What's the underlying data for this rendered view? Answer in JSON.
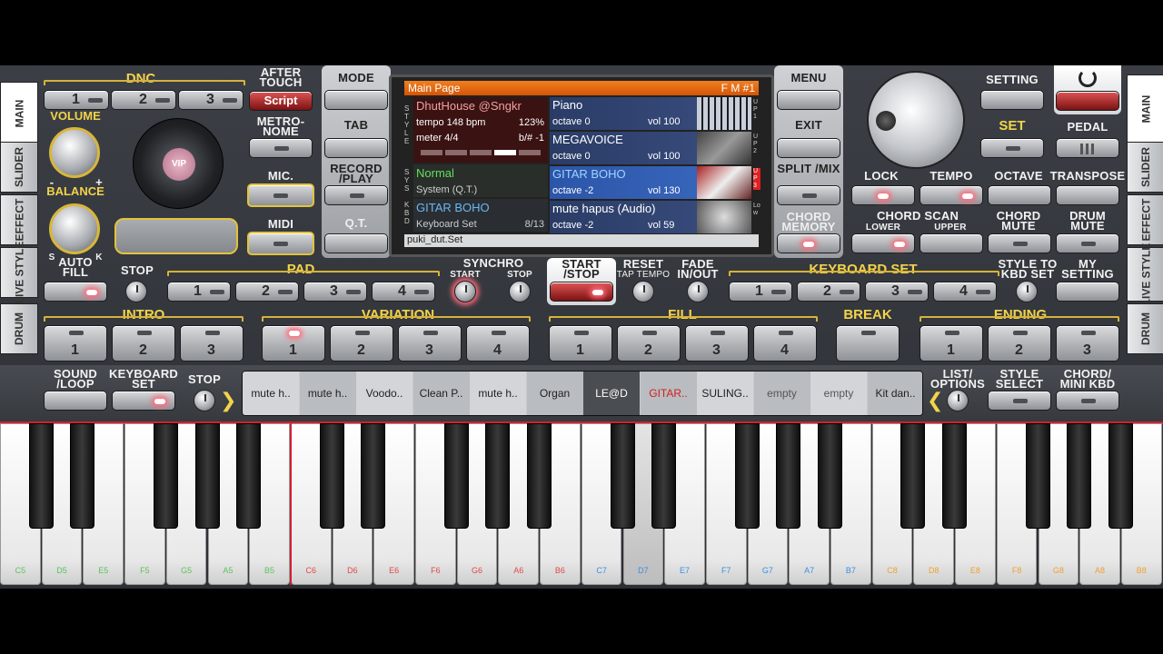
{
  "tabs_left": [
    "MAIN",
    "SLIDER",
    "EFFECT",
    "LIVE STYLE",
    "DRUM"
  ],
  "tabs_right": [
    "MAIN",
    "SLIDER",
    "EFFECT",
    "LIVE STYLE",
    "DRUM"
  ],
  "dnc": {
    "title": "DNC",
    "buttons": [
      "1",
      "2",
      "3"
    ]
  },
  "after_touch": {
    "label": "AFTER TOUCH",
    "value": "Script"
  },
  "metronome": "METRO- NOME",
  "mic": "MIC.",
  "midi": "MIDI",
  "volume": "VOLUME",
  "balance": "BALANCE",
  "balance_marks": {
    "minus": "-",
    "plus": "+",
    "s": "S",
    "k": "K"
  },
  "vip_logo": "VIP",
  "left_column": {
    "mode": "MODE",
    "tab": "TAB",
    "record": "RECORD /PLAY",
    "qt": "Q.T."
  },
  "right_column": {
    "menu": "MENU",
    "exit": "EXIT",
    "split": "SPLIT /MIX",
    "chord_memory": "CHORD MEMORY"
  },
  "screen": {
    "header": "Main Page",
    "fm": "F M #1",
    "side_style": "STYLE",
    "side_sys": "SYS",
    "side_kbd": "KBD",
    "style_name": "DhutHouse @Sngkr",
    "tempo": "tempo 148 bpm",
    "tempo_pct": "123%",
    "meter": "meter 4/4",
    "transpose": "b/# -1",
    "system_name": "Normal",
    "system_sub": "System (Q.T.)",
    "kbd_name": "GITAR BOHO",
    "kbd_sub": "Keyboard Set",
    "kbd_count": "8/13",
    "parts": [
      {
        "name": "Piano",
        "octave": "octave 0",
        "vol": "vol 100",
        "tag": "UP1"
      },
      {
        "name": "MEGAVOICE",
        "octave": "octave 0",
        "vol": "vol 100",
        "tag": "UP2"
      },
      {
        "name": "GITAR BOHO",
        "octave": "octave -2",
        "vol": "vol 130",
        "tag": "UP3"
      },
      {
        "name": "mute hapus (Audio)",
        "octave": "octave -2",
        "vol": "vol 59",
        "tag": "Low"
      }
    ],
    "footer": "puki_dut.Set"
  },
  "setting": "SETTING",
  "set": "SET",
  "pedal": "PEDAL",
  "lock": "LOCK",
  "tempo_btn": "TEMPO",
  "octave": "OCTAVE",
  "transpose_btn": "TRANSPOSE",
  "chord_scan": {
    "title": "CHORD SCAN",
    "lower": "LOWER",
    "upper": "UPPER"
  },
  "chord_mute": "CHORD MUTE",
  "drum_mute": "DRUM MUTE",
  "auto_fill": "AUTO FILL",
  "stop": "STOP",
  "pad": {
    "title": "PAD",
    "buttons": [
      "1",
      "2",
      "3",
      "4"
    ]
  },
  "synchro": {
    "title": "SYNCHRO",
    "start": "START",
    "stop": "STOP"
  },
  "start_stop": "START /STOP",
  "reset": {
    "title": "RESET",
    "sub": "TAP TEMPO"
  },
  "fade": "FADE IN/OUT",
  "keyboard_set": {
    "title": "KEYBOARD SET",
    "buttons": [
      "1",
      "2",
      "3",
      "4"
    ]
  },
  "style_to_kbd": "STYLE TO KBD SET",
  "my_setting": "MY SETTING",
  "intro": {
    "title": "INTRO",
    "buttons": [
      "1",
      "2",
      "3"
    ]
  },
  "variation": {
    "title": "VARIATION",
    "buttons": [
      "1",
      "2",
      "3",
      "4"
    ]
  },
  "fill": {
    "title": "FILL",
    "buttons": [
      "1",
      "2",
      "3",
      "4"
    ]
  },
  "break": "BREAK",
  "ending": {
    "title": "ENDING",
    "buttons": [
      "1",
      "2",
      "3"
    ]
  },
  "sound_loop": "SOUND /LOOP",
  "keyboard_set_btn": "KEYBOARD SET",
  "stop2": "STOP",
  "list_options": "LIST/ OPTIONS",
  "style_select": "STYLE SELECT",
  "chord_mini": "CHORD/ MINI KBD",
  "strip": [
    "mute h..",
    "mute h..",
    "Voodo..",
    "Clean P..",
    "mute h..",
    "Organ",
    "LE@D",
    "GITAR..",
    "SULING..",
    "empty",
    "empty",
    "Kit dan.."
  ],
  "keys": [
    "C5",
    "D5",
    "E5",
    "F5",
    "G5",
    "A5",
    "B5",
    "C6",
    "D6",
    "E6",
    "F6",
    "G6",
    "A6",
    "B6",
    "C7",
    "D7",
    "E7",
    "F7",
    "G7",
    "A7",
    "B7",
    "C8",
    "D8",
    "E8",
    "F8",
    "G8",
    "A8",
    "B8"
  ],
  "colors": {
    "accent": "#f3d34a",
    "screen_header": "#e86a10",
    "key_green": "#5cc25c",
    "key_red": "#e04848",
    "key_blue": "#3d8fe0",
    "key_orange": "#f0a030"
  }
}
